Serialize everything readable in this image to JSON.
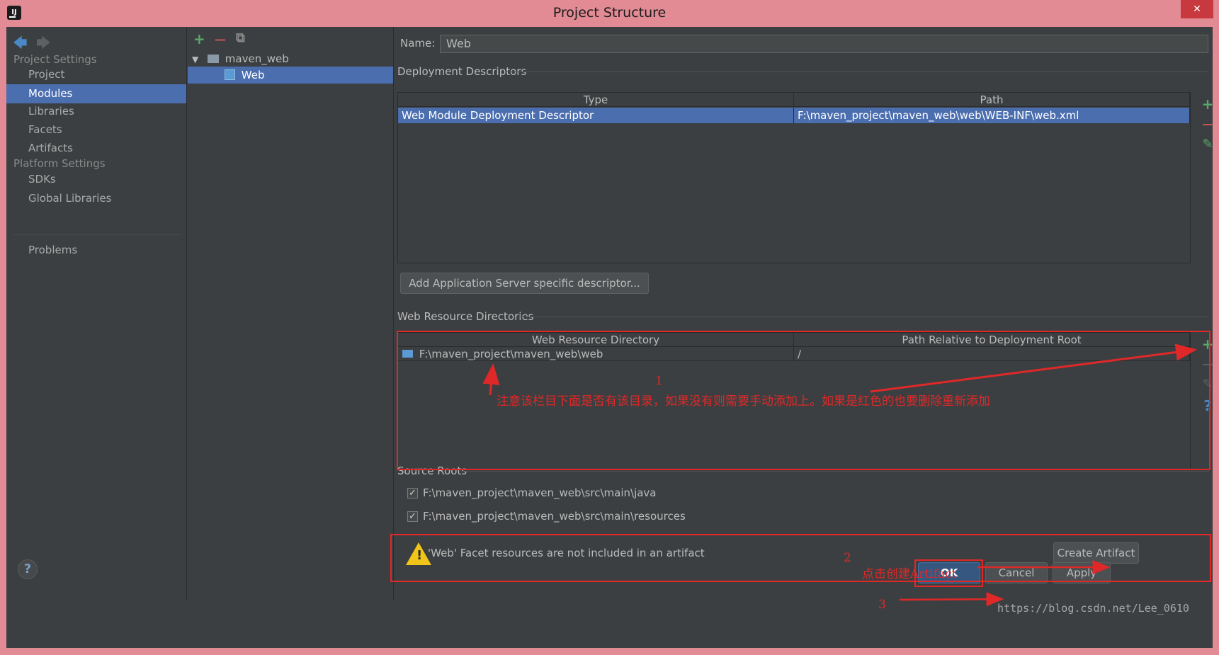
{
  "window": {
    "title": "Project Structure",
    "close_glyph": "✕",
    "app_icon_label": "IJ"
  },
  "nav": {
    "back_icon": "back-arrow-icon",
    "forward_icon": "forward-arrow-icon",
    "sections": [
      {
        "title": "Project Settings",
        "items": [
          "Project",
          "Modules",
          "Libraries",
          "Facets",
          "Artifacts"
        ]
      },
      {
        "title": "Platform Settings",
        "items": [
          "SDKs",
          "Global Libraries"
        ]
      }
    ],
    "problems": "Problems",
    "selected": "Modules"
  },
  "tree": {
    "toolbar": {
      "add": "+",
      "remove": "—",
      "copy": "⧉"
    },
    "root": "maven_web",
    "child": "Web"
  },
  "facet": {
    "name_label": "Name:",
    "name_value": "Web",
    "deployment": {
      "title": "Deployment Descriptors",
      "columns": [
        "Type",
        "Path"
      ],
      "rows": [
        {
          "type": "Web Module Deployment Descriptor",
          "path": "F:\\maven_project\\maven_web\\web\\WEB-INF\\web.xml"
        }
      ],
      "add_server_button": "Add Application Server specific descriptor..."
    },
    "web_resources": {
      "title": "Web Resource Directories",
      "columns": [
        "Web Resource Directory",
        "Path Relative to Deployment Root"
      ],
      "rows": [
        {
          "dir": "F:\\maven_project\\maven_web\\web",
          "rel": "/"
        }
      ]
    },
    "source_roots": {
      "title": "Source Roots",
      "items": [
        "F:\\maven_project\\maven_web\\src\\main\\java",
        "F:\\maven_project\\maven_web\\src\\main\\resources"
      ]
    },
    "warning": {
      "text": "'Web' Facet resources are not included in an artifact",
      "button": "Create Artifact"
    }
  },
  "tools": {
    "add": "+",
    "remove": "—",
    "edit": "✎",
    "help": "?"
  },
  "buttons": {
    "ok": "OK",
    "cancel": "Cancel",
    "apply": "Apply",
    "help": "?"
  },
  "annotations": {
    "n1": "1",
    "text1": "注意该栏目下面是否有该目录，如果没有则需要手动添加上。如果是红色的也要删除重新添加",
    "n2": "2",
    "text2": "点击创建Artifact",
    "n3": "3"
  },
  "watermark": "https://blog.csdn.net/Lee_0610",
  "colors": {
    "selection": "#4b6eaf",
    "panel": "#3c3f41",
    "annotation": "#e02828",
    "add_green": "#59a869",
    "remove_red": "#c75450"
  }
}
